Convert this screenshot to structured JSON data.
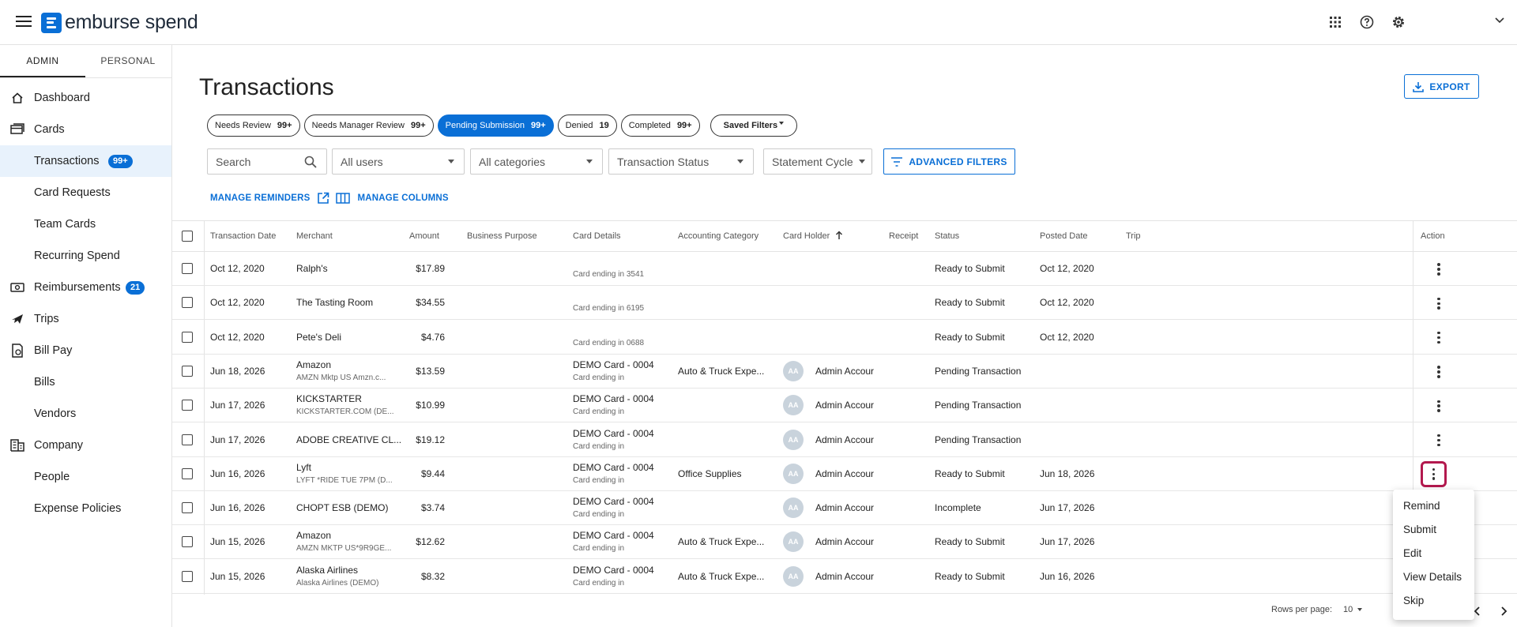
{
  "app": {
    "logo_text": "emburse spend"
  },
  "sidebar": {
    "tabs": [
      "ADMIN",
      "PERSONAL"
    ],
    "items": [
      {
        "label": "Dashboard",
        "icon": "home-icon"
      },
      {
        "label": "Cards",
        "icon": "cards-icon"
      },
      {
        "label": "Transactions",
        "badge": "99+"
      },
      {
        "label": "Card Requests"
      },
      {
        "label": "Team Cards"
      },
      {
        "label": "Recurring Spend"
      },
      {
        "label": "Reimbursements",
        "icon": "money-icon",
        "badge": "21"
      },
      {
        "label": "Trips",
        "icon": "plane-icon"
      },
      {
        "label": "Bill Pay",
        "icon": "bill-icon"
      },
      {
        "label": "Bills"
      },
      {
        "label": "Vendors"
      },
      {
        "label": "Company",
        "icon": "building-icon"
      },
      {
        "label": "People"
      },
      {
        "label": "Expense Policies"
      }
    ]
  },
  "main": {
    "title": "Transactions",
    "export_label": "EXPORT",
    "chips": [
      {
        "label": "Needs Review",
        "count": "99+"
      },
      {
        "label": "Needs Manager Review",
        "count": "99+"
      },
      {
        "label": "Pending Submission",
        "count": "99+"
      },
      {
        "label": "Denied",
        "count": "19"
      },
      {
        "label": "Completed",
        "count": "99+"
      },
      {
        "label": "Saved Filters"
      }
    ],
    "search_placeholder": "Search",
    "filters": [
      "All users",
      "All categories",
      "Transaction Status",
      "Statement Cycle"
    ],
    "advanced_filters_label": "ADVANCED FILTERS",
    "manage_reminders_label": "MANAGE REMINDERS",
    "manage_columns_label": "MANAGE COLUMNS"
  },
  "table": {
    "columns": [
      "Transaction Date",
      "Merchant",
      "Amount",
      "Business Purpose",
      "Card Details",
      "Accounting Category",
      "Card Holder",
      "Receipt",
      "Status",
      "Posted Date",
      "Trip",
      "Action"
    ],
    "rows": [
      {
        "date": "Oct 12, 2020",
        "merchant": "Ralph's",
        "merchant_sub": "",
        "amount": "$17.89",
        "card": "",
        "card_sub": "Card ending in 3541",
        "category": "",
        "holder": "",
        "avatar": "",
        "status": "Ready to Submit",
        "posted": "Oct 12, 2020"
      },
      {
        "date": "Oct 12, 2020",
        "merchant": "The Tasting Room",
        "merchant_sub": "",
        "amount": "$34.55",
        "card": "",
        "card_sub": "Card ending in 6195",
        "category": "",
        "holder": "",
        "avatar": "",
        "status": "Ready to Submit",
        "posted": "Oct 12, 2020"
      },
      {
        "date": "Oct 12, 2020",
        "merchant": "Pete's Deli",
        "merchant_sub": "",
        "amount": "$4.76",
        "card": "",
        "card_sub": "Card ending in 0688",
        "category": "",
        "holder": "",
        "avatar": "",
        "status": "Ready to Submit",
        "posted": "Oct 12, 2020"
      },
      {
        "date": "Jun 18, 2026",
        "merchant": "Amazon",
        "merchant_sub": "AMZN Mktp US Amzn.c...",
        "amount": "$13.59",
        "card": "DEMO Card - 0004",
        "card_sub": "Card ending in",
        "category": "Auto & Truck Expe...",
        "holder": "Admin Accour",
        "avatar": "AA",
        "status": "Pending Transaction",
        "posted": ""
      },
      {
        "date": "Jun 17, 2026",
        "merchant": "KICKSTARTER",
        "merchant_sub": "KICKSTARTER.COM (DE...",
        "amount": "$10.99",
        "card": "DEMO Card - 0004",
        "card_sub": "Card ending in",
        "category": "",
        "holder": "Admin Accour",
        "avatar": "AA",
        "status": "Pending Transaction",
        "posted": ""
      },
      {
        "date": "Jun 17, 2026",
        "merchant": "ADOBE CREATIVE CL...",
        "merchant_sub": "",
        "amount": "$19.12",
        "card": "DEMO Card - 0004",
        "card_sub": "Card ending in",
        "category": "",
        "holder": "Admin Accour",
        "avatar": "AA",
        "status": "Pending Transaction",
        "posted": ""
      },
      {
        "date": "Jun 16, 2026",
        "merchant": "Lyft",
        "merchant_sub": "LYFT *RIDE TUE 7PM (D...",
        "amount": "$9.44",
        "card": "DEMO Card - 0004",
        "card_sub": "Card ending in",
        "category": "Office Supplies",
        "holder": "Admin Accour",
        "avatar": "AA",
        "status": "Ready to Submit",
        "posted": "Jun 18, 2026"
      },
      {
        "date": "Jun 16, 2026",
        "merchant": "CHOPT ESB (DEMO)",
        "merchant_sub": "",
        "amount": "$3.74",
        "card": "DEMO Card - 0004",
        "card_sub": "Card ending in",
        "category": "",
        "holder": "Admin Accour",
        "avatar": "AA",
        "status": "Incomplete",
        "posted": "Jun 17, 2026"
      },
      {
        "date": "Jun 15, 2026",
        "merchant": "Amazon",
        "merchant_sub": "AMZN MKTP US*9R9GE...",
        "amount": "$12.62",
        "card": "DEMO Card - 0004",
        "card_sub": "Card ending in",
        "category": "Auto & Truck Expe...",
        "holder": "Admin Accour",
        "avatar": "AA",
        "status": "Ready to Submit",
        "posted": "Jun 17, 2026"
      },
      {
        "date": "Jun 15, 2026",
        "merchant": "Alaska Airlines",
        "merchant_sub": "Alaska Airlines (DEMO)",
        "amount": "$8.32",
        "card": "DEMO Card - 0004",
        "card_sub": "Card ending in",
        "category": "Auto & Truck Expe...",
        "holder": "Admin Accour",
        "avatar": "AA",
        "status": "Ready to Submit",
        "posted": "Jun 16, 2026"
      }
    ]
  },
  "action_menu": {
    "items": [
      "Remind",
      "Submit",
      "Edit",
      "View Details",
      "Skip"
    ]
  },
  "pagination": {
    "rows_per_page_label": "Rows per page:",
    "rows_per_page_value": "10"
  },
  "colors": {
    "accent": "#0a6fd6",
    "focus_ring": "#b3194e"
  }
}
